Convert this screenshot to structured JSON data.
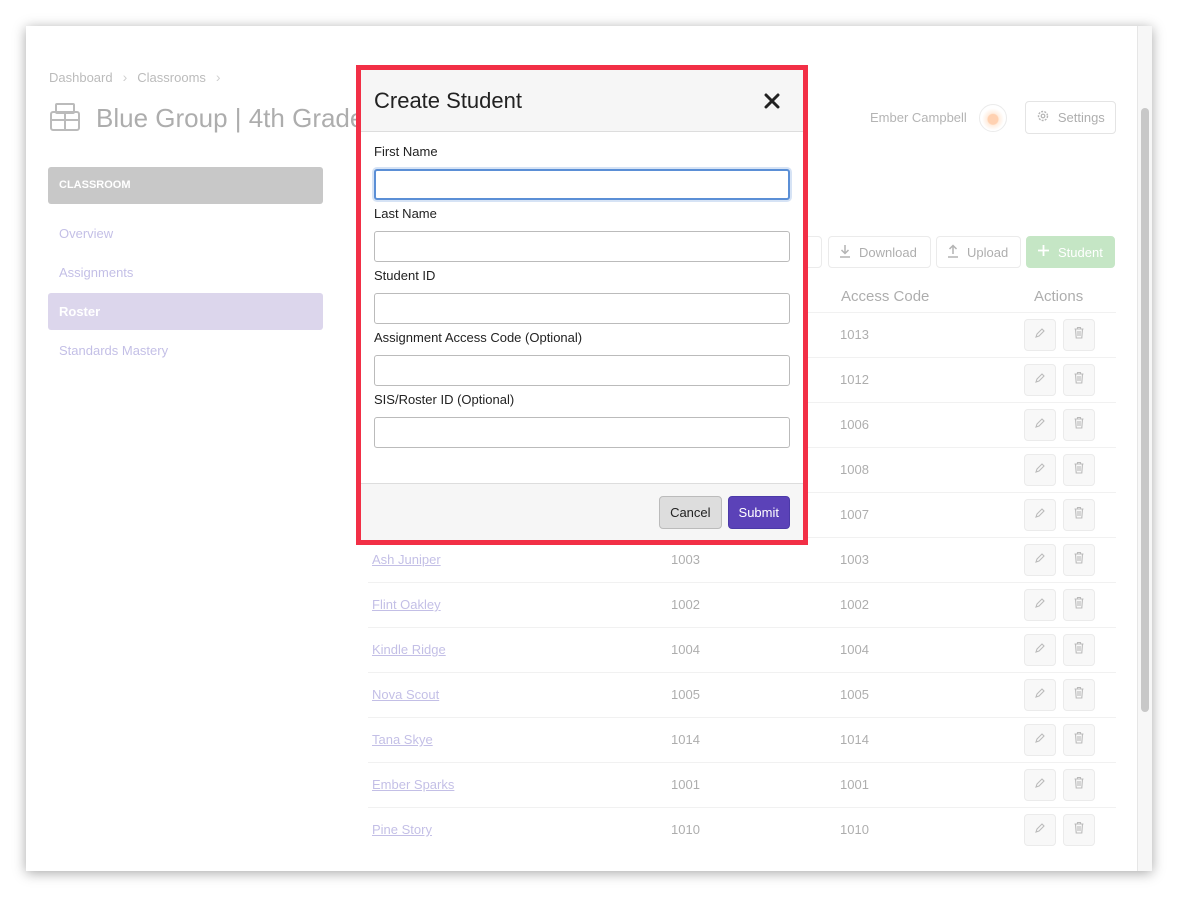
{
  "breadcrumb": {
    "items": [
      "Dashboard",
      "Classrooms"
    ]
  },
  "page": {
    "title": "Blue Group | 4th Grade"
  },
  "user": {
    "name": "Ember Campbell",
    "settings_label": "Settings"
  },
  "sidebar": {
    "header": "CLASSROOM",
    "items": [
      {
        "label": "Overview"
      },
      {
        "label": "Assignments"
      },
      {
        "label": "Roster"
      },
      {
        "label": "Standards Mastery"
      }
    ]
  },
  "toolbar": {
    "download_label": "Download",
    "upload_label": "Upload",
    "add_student_label": "Student"
  },
  "table": {
    "columns": {
      "access_code": "Access Code",
      "actions": "Actions"
    },
    "hidden_rows": [
      {
        "code": "1013"
      },
      {
        "code": "1012"
      },
      {
        "code": "1006"
      },
      {
        "code": "1008"
      },
      {
        "code": "1007"
      }
    ],
    "rows": [
      {
        "name": "Ash Juniper",
        "student_id": "1003",
        "access_code": "1003"
      },
      {
        "name": "Flint Oakley",
        "student_id": "1002",
        "access_code": "1002"
      },
      {
        "name": "Kindle Ridge",
        "student_id": "1004",
        "access_code": "1004"
      },
      {
        "name": "Nova Scout",
        "student_id": "1005",
        "access_code": "1005"
      },
      {
        "name": "Tana Skye",
        "student_id": "1014",
        "access_code": "1014"
      },
      {
        "name": "Ember Sparks",
        "student_id": "1001",
        "access_code": "1001"
      },
      {
        "name": "Pine Story",
        "student_id": "1010",
        "access_code": "1010"
      }
    ]
  },
  "modal": {
    "title": "Create Student",
    "fields": [
      {
        "label": "First Name",
        "value": ""
      },
      {
        "label": "Last Name",
        "value": ""
      },
      {
        "label": "Student ID",
        "value": ""
      },
      {
        "label": "Assignment Access Code (Optional)",
        "value": ""
      },
      {
        "label": "SIS/Roster ID (Optional)",
        "value": ""
      }
    ],
    "cancel_label": "Cancel",
    "submit_label": "Submit"
  },
  "colors": {
    "highlight_border": "#f22f46",
    "submit": "#5b42b8",
    "accent": "#6a5fc1",
    "add_button": "#6fc06f"
  }
}
